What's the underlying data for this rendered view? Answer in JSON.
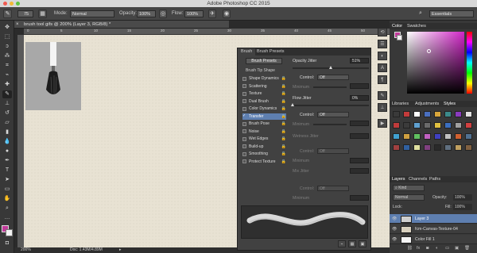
{
  "app": {
    "window_title": "Adobe Photoshop CC 2015",
    "workspace": "Essentials"
  },
  "options_bar": {
    "brush_size": "75",
    "mode_label": "Mode:",
    "mode_value": "Normal",
    "opacity_label": "Opacity:",
    "opacity_value": "100%",
    "flow_label": "Flow:",
    "flow_value": "100%"
  },
  "document": {
    "tab_title": "brush tool gifs @ 200% (Layer 3, RGB/8) *",
    "ruler_marks": [
      "0",
      "5",
      "10",
      "15",
      "20",
      "25",
      "30",
      "35",
      "40",
      "45",
      "50"
    ],
    "zoom": "200%",
    "doc_size": "Doc: 1.43M/4.89M"
  },
  "brush_panel": {
    "tabs": [
      "Brush",
      "Brush Presets"
    ],
    "presets_button": "Brush Presets",
    "tip_shape": "Brush Tip Shape",
    "items": [
      {
        "label": "Shape Dynamics",
        "checked": false,
        "active": false
      },
      {
        "label": "Scattering",
        "checked": false,
        "active": false
      },
      {
        "label": "Texture",
        "checked": false,
        "active": false
      },
      {
        "label": "Dual Brush",
        "checked": false,
        "active": false
      },
      {
        "label": "Color Dynamics",
        "checked": false,
        "active": false
      },
      {
        "label": "Transfer",
        "checked": true,
        "active": true
      },
      {
        "label": "Brush Pose",
        "checked": false,
        "active": false
      },
      {
        "label": "Noise",
        "checked": false,
        "active": false
      },
      {
        "label": "Wet Edges",
        "checked": false,
        "active": false
      },
      {
        "label": "Build-up",
        "checked": false,
        "active": false
      },
      {
        "label": "Smoothing",
        "checked": false,
        "active": false
      },
      {
        "label": "Protect Texture",
        "checked": false,
        "active": false
      }
    ],
    "opacity_jitter_label": "Opacity Jitter",
    "opacity_jitter_value": "51%",
    "control_label": "Control:",
    "control_value": "Off",
    "minimum_label": "Minimum",
    "flow_jitter_label": "Flow Jitter",
    "flow_jitter_value": "0%",
    "wetness_jitter_label": "Wetness Jitter",
    "mix_jitter_label": "Mix Jitter",
    "opacity_jitter_level": 0.51,
    "flow_jitter_level": 0
  },
  "color_panel": {
    "tabs": [
      "Color",
      "Swatches"
    ]
  },
  "libraries_panel": {
    "tabs": [
      "Libraries",
      "Adjustments",
      "Styles"
    ]
  },
  "layers_panel": {
    "tabs": [
      "Layers",
      "Channels",
      "Paths"
    ],
    "kind_label": "Kind",
    "blend_mode": "Normal",
    "opacity_label": "Opacity:",
    "opacity_value": "100%",
    "lock_label": "Lock:",
    "fill_label": "Fill:",
    "fill_value": "100%",
    "layers": [
      {
        "name": "Layer 3",
        "selected": true
      },
      {
        "name": "fcm-Canvas-Texture-04",
        "selected": false
      },
      {
        "name": "Color Fill 1",
        "selected": false
      }
    ]
  }
}
